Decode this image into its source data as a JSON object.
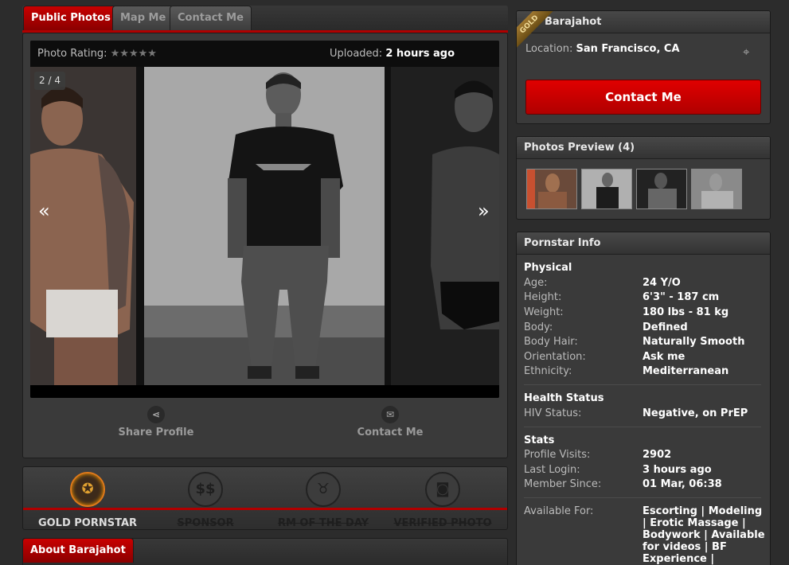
{
  "tabs": {
    "public_photos": "Public Photos",
    "map_me": "Map Me",
    "contact_me": "Contact Me"
  },
  "viewer": {
    "rating_label": "Photo Rating:",
    "stars": "★★★★★",
    "uploaded_label": "Uploaded:",
    "uploaded_value": "2 hours ago",
    "counter": "2 / 4",
    "prev": "«",
    "next": "»"
  },
  "actions": {
    "share": "Share Profile",
    "contact": "Contact Me"
  },
  "badges": [
    {
      "label": "GOLD PORNSTAR",
      "active": true
    },
    {
      "label": "SPONSOR",
      "active": false
    },
    {
      "label": "RM OF THE DAY",
      "active": false
    },
    {
      "label": "VERIFIED PHOTO",
      "active": false
    }
  ],
  "about_tab": "About Barajahot",
  "profile": {
    "name": "Barajahot",
    "ribbon": "GOLD",
    "location_label": "Location:",
    "location": "San Francisco, CA",
    "contact_button": "Contact Me"
  },
  "photos_preview": {
    "title": "Photos Preview (4)"
  },
  "info": {
    "title": "Pornstar Info",
    "physical_title": "Physical",
    "physical": [
      {
        "k": "Age:",
        "v": "24 Y/O"
      },
      {
        "k": "Height:",
        "v": "6'3\" - 187 cm"
      },
      {
        "k": "Weight:",
        "v": "180 lbs - 81 kg"
      },
      {
        "k": "Body:",
        "v": "Defined"
      },
      {
        "k": "Body Hair:",
        "v": "Naturally Smooth"
      },
      {
        "k": "Orientation:",
        "v": "Ask me"
      },
      {
        "k": "Ethnicity:",
        "v": "Mediterranean"
      }
    ],
    "health_title": "Health Status",
    "health": [
      {
        "k": "HIV Status:",
        "v": "Negative, on PrEP"
      }
    ],
    "stats_title": "Stats",
    "stats": [
      {
        "k": "Profile Visits:",
        "v": "2902"
      },
      {
        "k": "Last Login:",
        "v": "3 hours ago"
      },
      {
        "k": "Member Since:",
        "v": "01 Mar, 06:38"
      }
    ],
    "available_label": "Available For:",
    "available_lines": [
      "Escorting | Modeling",
      "| Erotic Massage |",
      "Bodywork | Available",
      "for videos | BF",
      "Experience |"
    ]
  }
}
